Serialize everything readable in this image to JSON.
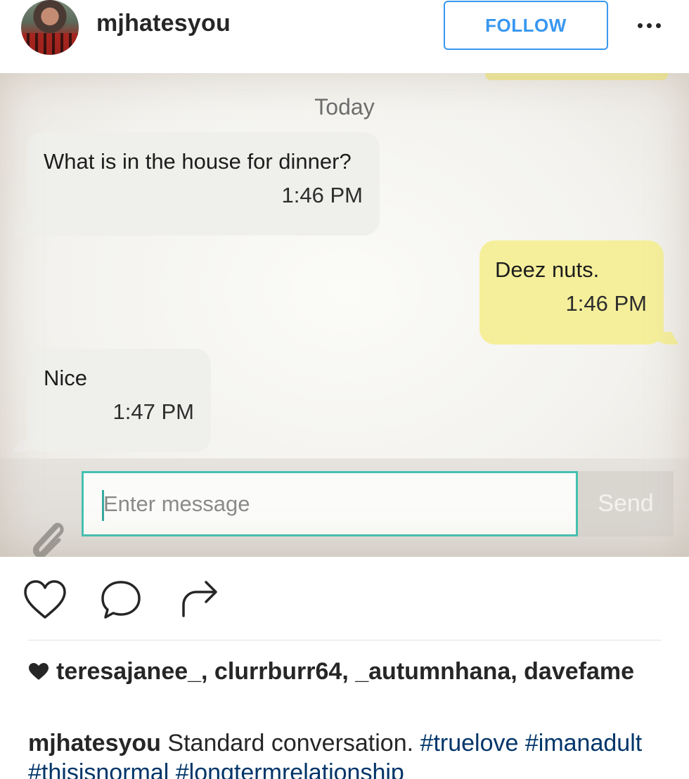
{
  "header": {
    "username": "mjhatesyou",
    "follow_label": "FOLLOW",
    "more_icon": "more-horizontal-icon"
  },
  "chat": {
    "date_label": "Today",
    "messages": [
      {
        "direction": "incoming",
        "text": "What is in the house for dinner?",
        "time": "1:46 PM"
      },
      {
        "direction": "outgoing",
        "text": "Deez nuts.",
        "time": "1:46 PM"
      },
      {
        "direction": "incoming",
        "text": "Nice",
        "time": "1:47 PM"
      }
    ],
    "input_placeholder": "Enter message",
    "send_label": "Send",
    "attach_icon": "paperclip-icon",
    "colors": {
      "incoming_bubble": "#efefec",
      "outgoing_bubble": "#f5ef9b",
      "input_border": "#44c1b2"
    }
  },
  "actions": {
    "like_icon": "heart-icon",
    "comment_icon": "comment-icon",
    "share_icon": "share-icon"
  },
  "likes": {
    "icon": "heart-filled-icon",
    "text": "teresajanee_, clurrburr64, _autumnhana, davefame"
  },
  "caption": {
    "author": "mjhatesyou",
    "text": "Standard conversation.",
    "hashtags": [
      "#truelove",
      "#imanadult",
      "#thisisnormal",
      "#longtermrelationship"
    ]
  },
  "colors": {
    "follow_blue": "#3897f0",
    "hashtag_blue": "#003569"
  }
}
